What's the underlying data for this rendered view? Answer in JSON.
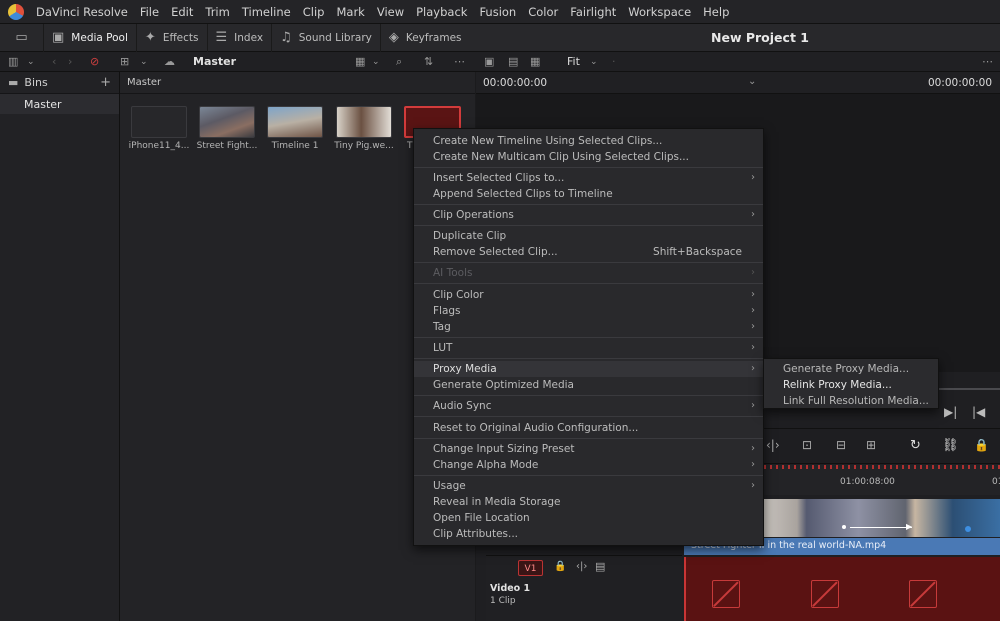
{
  "menubar": {
    "items": [
      "DaVinci Resolve",
      "File",
      "Edit",
      "Trim",
      "Timeline",
      "Clip",
      "Mark",
      "View",
      "Playback",
      "Fusion",
      "Color",
      "Fairlight",
      "Workspace",
      "Help"
    ]
  },
  "toolbar": {
    "media_pool": "Media Pool",
    "effects": "Effects",
    "index": "Index",
    "sound_library": "Sound Library",
    "keyframes": "Keyframes",
    "project_title": "New Project 1"
  },
  "row2": {
    "bin_name": "Master",
    "zoom": "Fit",
    "timecode_left": "00:00:00:00",
    "timecode_right": "00:00:00:00"
  },
  "bins": {
    "header": "Bins",
    "items": [
      "Master"
    ]
  },
  "media_pool": {
    "path": "Master",
    "clips": [
      {
        "label": "iPhone11_4..."
      },
      {
        "label": "Street Fight..."
      },
      {
        "label": "Timeline 1"
      },
      {
        "label": "Tiny Pig.we..."
      },
      {
        "label": "Ti"
      }
    ]
  },
  "context_menu": {
    "items": [
      {
        "label": "Create New Timeline Using Selected Clips..."
      },
      {
        "label": "Create New Multicam Clip Using Selected Clips..."
      },
      {
        "label": "Insert Selected Clips to..."
      },
      {
        "label": "Append Selected Clips to Timeline"
      },
      {
        "label": "Clip Operations"
      },
      {
        "label": "Duplicate Clip"
      },
      {
        "label": "Remove Selected Clip...",
        "shortcut": "Shift+Backspace"
      },
      {
        "label": "AI Tools"
      },
      {
        "label": "Clip Color"
      },
      {
        "label": "Flags"
      },
      {
        "label": "Tag"
      },
      {
        "label": "LUT"
      },
      {
        "label": "Proxy Media"
      },
      {
        "label": "Generate Optimized Media"
      },
      {
        "label": "Audio Sync"
      },
      {
        "label": "Reset to Original Audio Configuration..."
      },
      {
        "label": "Change Input Sizing Preset"
      },
      {
        "label": "Change Alpha Mode"
      },
      {
        "label": "Usage"
      },
      {
        "label": "Reveal in Media Storage"
      },
      {
        "label": "Open File Location"
      },
      {
        "label": "Clip Attributes..."
      }
    ]
  },
  "submenu": {
    "items": [
      {
        "label": "Generate Proxy Media..."
      },
      {
        "label": "Relink Proxy Media..."
      },
      {
        "label": "Link Full Resolution Media..."
      }
    ]
  },
  "timeline": {
    "ruler_timecode": "01:00:08:00",
    "ruler_timecode_cut": "01",
    "track_badge": "V1",
    "track_name": "Video 1",
    "track_count": "1 Clip",
    "clip_name": "Street Fighter II in the real world-NA.mp4"
  },
  "colors": {
    "accent_red": "#c93535",
    "clip_blue": "#4a79b5"
  }
}
